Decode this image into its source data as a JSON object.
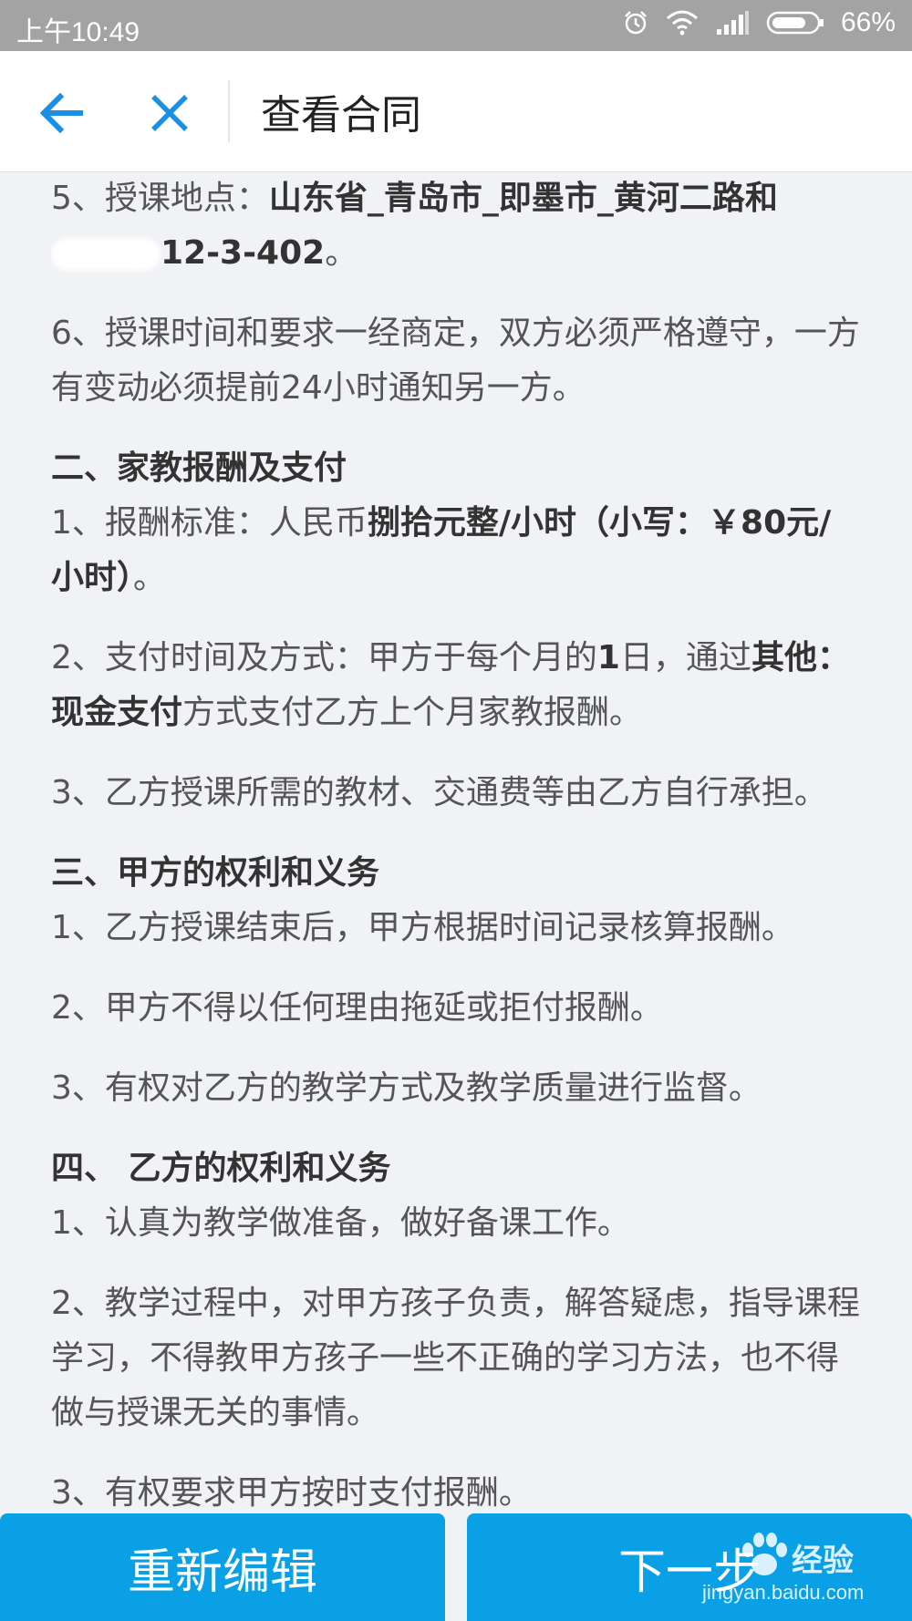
{
  "status_bar": {
    "time": "上午10:49",
    "battery": "66%"
  },
  "nav": {
    "title": "查看合同",
    "back_icon": "arrow-left-icon",
    "close_icon": "close-icon",
    "accent_color": "#1a8fe3"
  },
  "contract": {
    "item5_prefix": "5、授课地点：",
    "item5_bold": "山东省_青岛市_即墨市_黄河二路和",
    "item5_bold2": "12-3-402",
    "item5_suffix": "。",
    "item6": "6、授课时间和要求一经商定，双方必须严格遵守，一方有变动必须提前24小时通知另一方。",
    "section2_heading": "二、家教报酬及支付",
    "s2_item1_prefix": "1、报酬标准：人民币",
    "s2_item1_bold": "捌拾元整/小时（小写：￥80元/小时）",
    "s2_item1_suffix": "。",
    "s2_item2_prefix": "2、支付时间及方式：甲方于每个月的",
    "s2_item2_bold1": "1",
    "s2_item2_mid": "日，通过",
    "s2_item2_bold2": "其他：现金支付",
    "s2_item2_suffix": "方式支付乙方上个月家教报酬。",
    "s2_item3": "3、乙方授课所需的教材、交通费等由乙方自行承担。",
    "section3_heading": "三、甲方的权利和义务",
    "s3_item1": "1、乙方授课结束后，甲方根据时间记录核算报酬。",
    "s3_item2": "2、甲方不得以任何理由拖延或拒付报酬。",
    "s3_item3": "3、有权对乙方的教学方式及教学质量进行监督。",
    "section4_heading": "四、 乙方的权利和义务",
    "s4_item1": "1、认真为教学做准备，做好备课工作。",
    "s4_item2": "2、教学过程中，对甲方孩子负责，解答疑虑，指导课程学习，不得教甲方孩子一些不正确的学习方法，也不得做与授课无关的事情。",
    "s4_item3_partial": "3、有权要求甲方按时支付报酬。"
  },
  "footer": {
    "reedit_label": "重新编辑",
    "next_label": "下一步",
    "button_color": "#0aa0e6"
  },
  "watermark": {
    "brand": "经验",
    "url": "jingyan.baidu.com"
  }
}
